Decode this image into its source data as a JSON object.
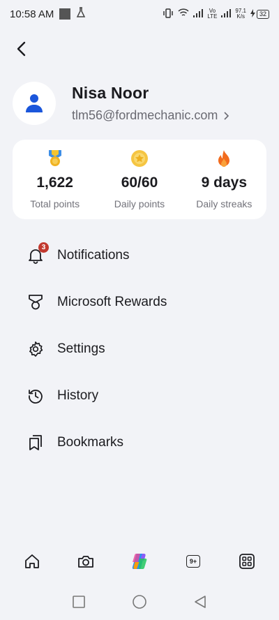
{
  "status_bar": {
    "time": "10:58 AM",
    "net_speed": "97.1",
    "net_unit": "K/s",
    "battery": "32",
    "volte_top": "Vo",
    "volte_bottom": "LTE"
  },
  "profile": {
    "name": "Nisa Noor",
    "email": "tlm56@fordmechanic.com"
  },
  "stats": [
    {
      "value": "1,622",
      "label": "Total points",
      "icon": "medal-icon"
    },
    {
      "value": "60/60",
      "label": "Daily points",
      "icon": "coin-icon"
    },
    {
      "value": "9 days",
      "label": "Daily streaks",
      "icon": "flame-icon"
    }
  ],
  "menu": [
    {
      "label": "Notifications",
      "icon": "bell-icon",
      "badge": "3"
    },
    {
      "label": "Microsoft Rewards",
      "icon": "trophy-icon"
    },
    {
      "label": "Settings",
      "icon": "gear-icon"
    },
    {
      "label": "History",
      "icon": "history-icon"
    },
    {
      "label": "Bookmarks",
      "icon": "bookmarks-icon"
    }
  ],
  "bottom_nav": {
    "tabs_count": "9+"
  },
  "colors": {
    "background": "#f2f3f7",
    "card": "#ffffff",
    "accent_blue": "#1a56db",
    "badge_red": "#c2392f"
  }
}
